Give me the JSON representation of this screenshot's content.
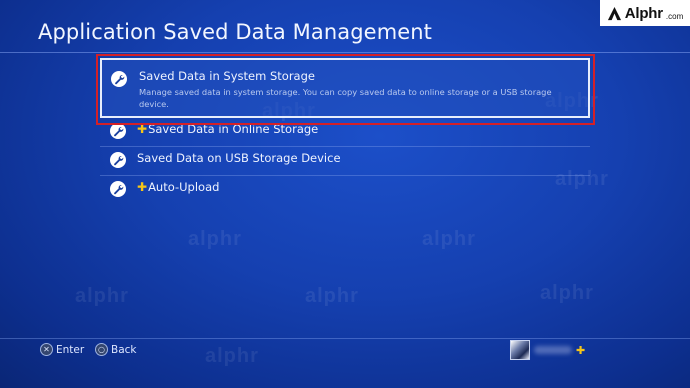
{
  "brand": {
    "name": "Alphr",
    "tld": ".com"
  },
  "title": "Application Saved Data Management",
  "menu": {
    "items": [
      {
        "label": "Saved Data in System Storage",
        "description": "Manage saved data in system storage. You can copy saved data to online storage or a USB storage device.",
        "icon": "wrench-icon",
        "plus": false,
        "selected": true
      },
      {
        "label": "Saved Data in Online Storage",
        "icon": "wrench-icon",
        "plus": true,
        "selected": false
      },
      {
        "label": "Saved Data on USB Storage Device",
        "icon": "wrench-icon",
        "plus": false,
        "selected": false
      },
      {
        "label": "Auto-Upload",
        "icon": "wrench-icon",
        "plus": true,
        "selected": false
      }
    ]
  },
  "footer": {
    "enter_label": "Enter",
    "back_label": "Back"
  },
  "watermark": "alphr",
  "colors": {
    "background": "#1540b0",
    "highlight_box": "#d42027",
    "plus_gold": "#f5c518"
  }
}
